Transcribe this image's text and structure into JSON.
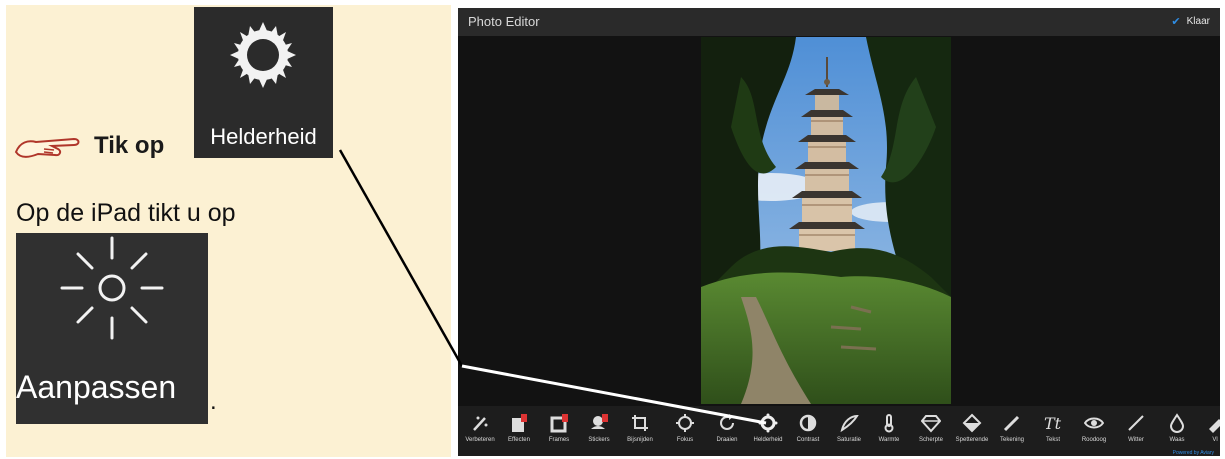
{
  "instruction": {
    "tap_text": "Tik op",
    "button_label": "Helderheid",
    "ipad_text": "Op de iPad tikt u op",
    "ipad_button_label": "Aanpassen",
    "trailing_period": "."
  },
  "editor": {
    "title": "Photo Editor",
    "done_label": "Klaar",
    "powered_by": "Powered by Aviary",
    "accent_color": "#2f8de4",
    "tools": [
      {
        "label": "Verbeteren",
        "icon": "magic-wand-icon"
      },
      {
        "label": "Effecten",
        "icon": "effects-icon"
      },
      {
        "label": "Frames",
        "icon": "frame-icon"
      },
      {
        "label": "Stickers",
        "icon": "sticker-icon"
      },
      {
        "label": "Bijsnijden",
        "icon": "crop-icon"
      },
      {
        "label": "Fokus",
        "icon": "focus-icon"
      },
      {
        "label": "Draaien",
        "icon": "rotate-icon"
      },
      {
        "label": "Helderheid",
        "icon": "brightness-icon"
      },
      {
        "label": "Contrast",
        "icon": "contrast-icon"
      },
      {
        "label": "Saturatie",
        "icon": "saturation-icon"
      },
      {
        "label": "Warmte",
        "icon": "thermometer-icon"
      },
      {
        "label": "Scherpte",
        "icon": "diamond-icon"
      },
      {
        "label": "Spetterende",
        "icon": "splash-icon"
      },
      {
        "label": "Tekening",
        "icon": "pencil-icon"
      },
      {
        "label": "Tekst",
        "icon": "text-icon"
      },
      {
        "label": "Roodoog",
        "icon": "eye-icon"
      },
      {
        "label": "Witter",
        "icon": "whiten-icon"
      },
      {
        "label": "Waas",
        "icon": "drop-icon"
      },
      {
        "label": "Vl",
        "icon": "blemish-icon"
      }
    ]
  }
}
